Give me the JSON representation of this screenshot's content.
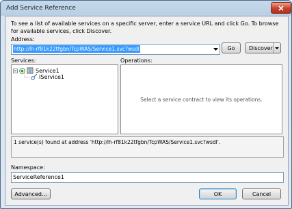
{
  "window": {
    "title": "Add Service Reference"
  },
  "intro_text": "To see a list of available services on a specific server, enter a service URL and click Go. To browse for available services, click Discover.",
  "address": {
    "label": "Address:",
    "value": "http://lh-rf81k22tfgbn/TcpWAS/Service1.svc?wsdl",
    "go_label": "Go",
    "discover_label": "Discover"
  },
  "services": {
    "label": "Services:",
    "tree": [
      {
        "label": "Service1",
        "icon": "service-icon",
        "expanded": true
      },
      {
        "label": "IService1",
        "icon": "interface-icon"
      }
    ]
  },
  "operations": {
    "label": "Operations:",
    "empty_message": "Select a service contract to view its operations."
  },
  "status_message": "1 service(s) found at address 'http://lh-rf81k22tfgbn/TcpWAS/Service1.svc?wsdl'.",
  "namespace": {
    "label": "Namespace:",
    "value": "ServiceReference1"
  },
  "buttons": {
    "advanced": "Advanced...",
    "ok": "OK",
    "cancel": "Cancel"
  },
  "colors": {
    "selection": "#3399ff",
    "title_bar": "#b9cfe4",
    "close_button": "#c8402a"
  }
}
